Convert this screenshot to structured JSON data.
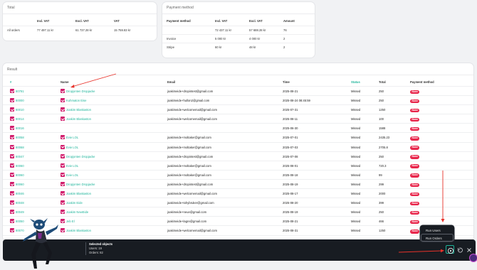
{
  "total": {
    "title": "Total",
    "headers": [
      "",
      "Incl. VAT",
      "Excl. VAT",
      "VAT"
    ],
    "rows": [
      [
        "All orders",
        "77 497.11 kr",
        "61 737.28 kr",
        "15 759.83 kr"
      ]
    ]
  },
  "payment": {
    "title": "Payment method",
    "headers": [
      "Payment method",
      "Incl. VAT",
      "Excl. VAT",
      "Amount"
    ],
    "rows": [
      [
        "",
        "72 437.11 kr",
        "57 688.28 kr",
        "76"
      ],
      [
        "Invoice",
        "5 000 kr",
        "4 000 kr",
        "2"
      ],
      [
        "Stripe",
        "60 kr",
        "48 kr",
        "2"
      ]
    ]
  },
  "result": {
    "title": "Result",
    "headers": {
      "id": "#",
      "name": "Name",
      "email": "Email",
      "time": "Time",
      "status": "Status",
      "total": "Total",
      "payment": "Payment method"
    },
    "rows": [
      {
        "id": "80781",
        "name": "Dropjonten Dropjacke",
        "email": "joakimeide+dropintest@gmail.com",
        "time": "2025-08-21",
        "status": "Missed",
        "total": "250",
        "payment": "None"
      },
      {
        "id": "80000",
        "name": "Kuhmaton Eise",
        "email": "joakimeide+hullon2@gmail.com",
        "time": "2025-08-24 08:45:59",
        "status": "Missed",
        "total": "250",
        "payment": "None"
      },
      {
        "id": "80010",
        "name": "Joakim Blaskaston",
        "email": "joakimeide+welcomemail@gmail.com",
        "time": "2025-07-31",
        "status": "Missed",
        "total": "1250",
        "payment": "None"
      },
      {
        "id": "80014",
        "name": "Joakim Blaskaston",
        "email": "joakimeide+welcomemail@gmail.com",
        "time": "2025-08-11",
        "status": "Missed",
        "total": "100",
        "payment": "None"
      },
      {
        "id": "80016",
        "name": "",
        "email": "",
        "time": "2025-06-30",
        "status": "Missed",
        "total": "1588",
        "payment": "None"
      },
      {
        "id": "80058",
        "name": "Evie LOL",
        "email": "joakimeide+moltaker@gmail.com",
        "time": "2025-07-01",
        "status": "Missed",
        "total": "2435.23",
        "payment": "None"
      },
      {
        "id": "80068",
        "name": "Evie LOL",
        "email": "joakimeide+moltaker@gmail.com",
        "time": "2025-07-03",
        "status": "Missed",
        "total": "2705.8",
        "payment": "None"
      },
      {
        "id": "80047",
        "name": "Dropjonten Dropjacke",
        "email": "joakimeide+dropintest@gmail.com",
        "time": "2025-07-08",
        "status": "Missed",
        "total": "250",
        "payment": "None"
      },
      {
        "id": "80060",
        "name": "Evie LOL",
        "email": "joakimeide+moltaker@gmail.com",
        "time": "2025-08-01",
        "status": "Missed",
        "total": "720.3",
        "payment": "None"
      },
      {
        "id": "80060",
        "name": "Evie LOL",
        "email": "joakimeide+moltaker@gmail.com",
        "time": "2025-08-18",
        "status": "Missed",
        "total": "99",
        "payment": "None"
      },
      {
        "id": "80060",
        "name": "Dropjonten Dropjacke",
        "email": "joakimeide+dropintest@gmail.com",
        "time": "2025-08-19",
        "status": "Missed",
        "total": "299",
        "payment": "None"
      },
      {
        "id": "80046",
        "name": "Joakim Blaskaston",
        "email": "joakimeide+welcomemail@gmail.com",
        "time": "2025-08-17",
        "status": "Missed",
        "total": "2000",
        "payment": "None"
      },
      {
        "id": "80048",
        "name": "Joakim Eide",
        "email": "joakimeide+tohybruker@gmail.com",
        "time": "2025-08-20",
        "status": "Missed",
        "total": "399",
        "payment": "None"
      },
      {
        "id": "80049",
        "name": "Joakim NewEide",
        "email": "joakimeide+neue@gmail.com",
        "time": "2025-08-19",
        "status": "Missed",
        "total": "250",
        "payment": "None"
      },
      {
        "id": "80050",
        "name": "Jeb El",
        "email": "joakimeide+lagre@gmail.com",
        "time": "2025-08-21",
        "status": "Missed",
        "total": "466",
        "payment": "None"
      },
      {
        "id": "80070",
        "name": "Joakim Blaskaston",
        "email": "joakimeide+welcomemail@gmail.com",
        "time": "2025-08-31",
        "status": "Missed",
        "total": "1250",
        "payment": "None"
      }
    ]
  },
  "selection": {
    "title": "Selected objects",
    "users": "Users: 19",
    "orders": "Orders: 82"
  },
  "menu": {
    "items": [
      "Run Users",
      "Run Orders"
    ]
  },
  "colors": {
    "accent": "#1db49a",
    "checkbox": "#d11d6c",
    "badge": "#e8264b",
    "annotation": "#e8322a",
    "bar": "#181c22"
  },
  "icons": [
    "checkbox-icon",
    "play-icon",
    "undo-icon",
    "close-icon",
    "mascot-figure"
  ]
}
